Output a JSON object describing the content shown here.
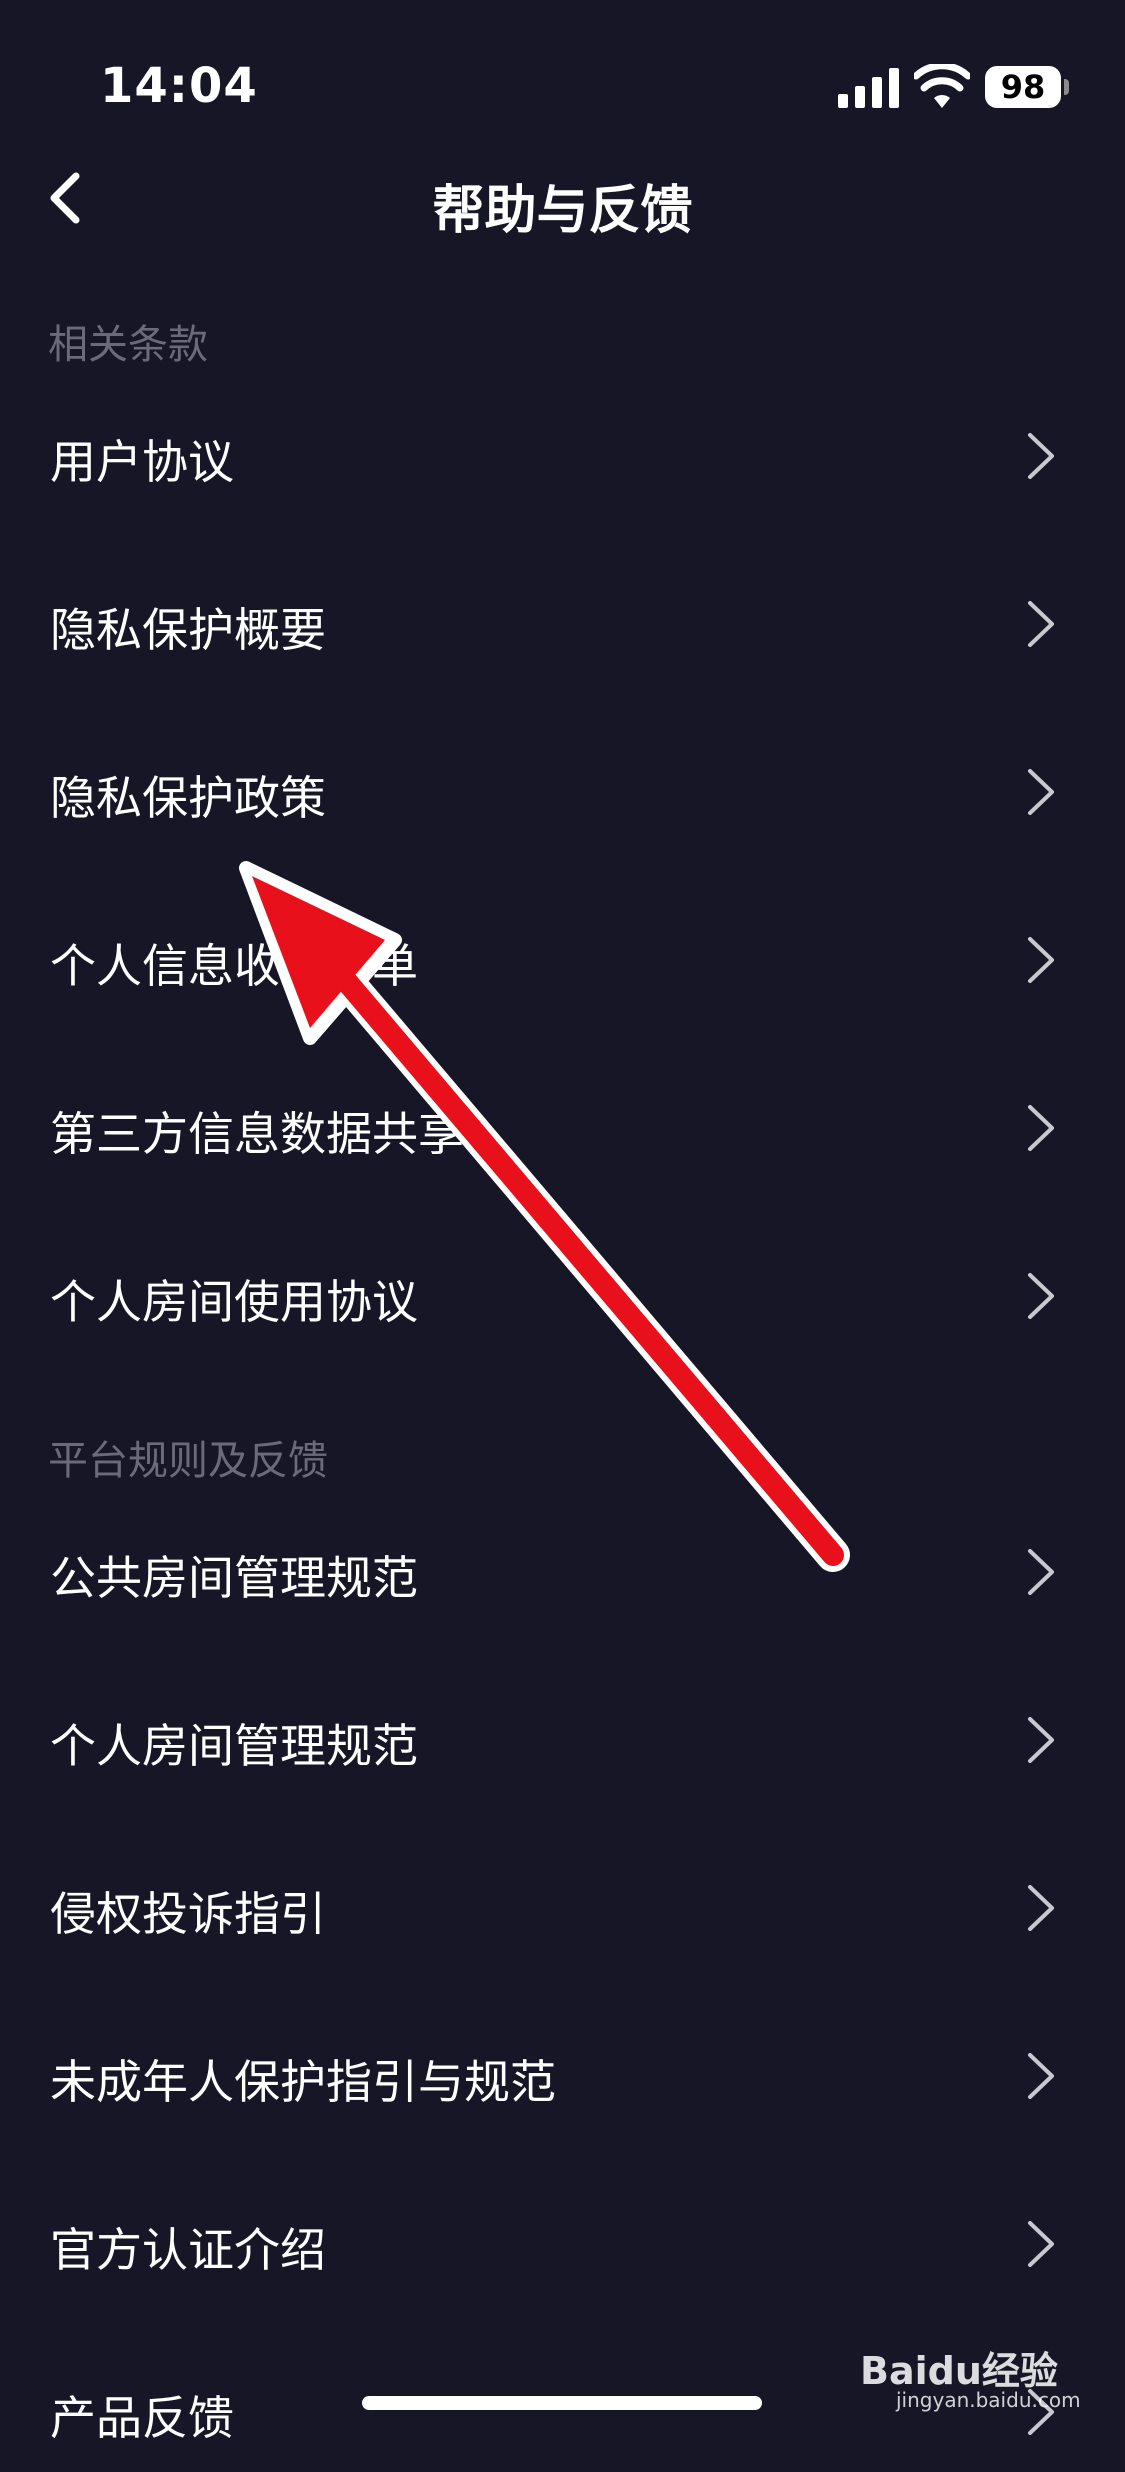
{
  "status_bar": {
    "time": "14:04",
    "battery": "98"
  },
  "nav": {
    "title": "帮助与反馈"
  },
  "sections": [
    {
      "header": "相关条款",
      "items": [
        "用户协议",
        "隐私保护概要",
        "隐私保护政策",
        "个人信息收集清单",
        "第三方信息数据共享",
        "个人房间使用协议"
      ]
    },
    {
      "header": "平台规则及反馈",
      "items": [
        "公共房间管理规范",
        "个人房间管理规范",
        "侵权投诉指引",
        "未成年人保护指引与规范",
        "官方认证介绍",
        "产品反馈"
      ]
    }
  ],
  "watermark": {
    "brand": "Baidu经验",
    "url": "jingyan.baidu.com"
  },
  "colors": {
    "background": "#171627",
    "section_header": "#6a6a7a",
    "annotation_arrow": "#e8101a"
  }
}
